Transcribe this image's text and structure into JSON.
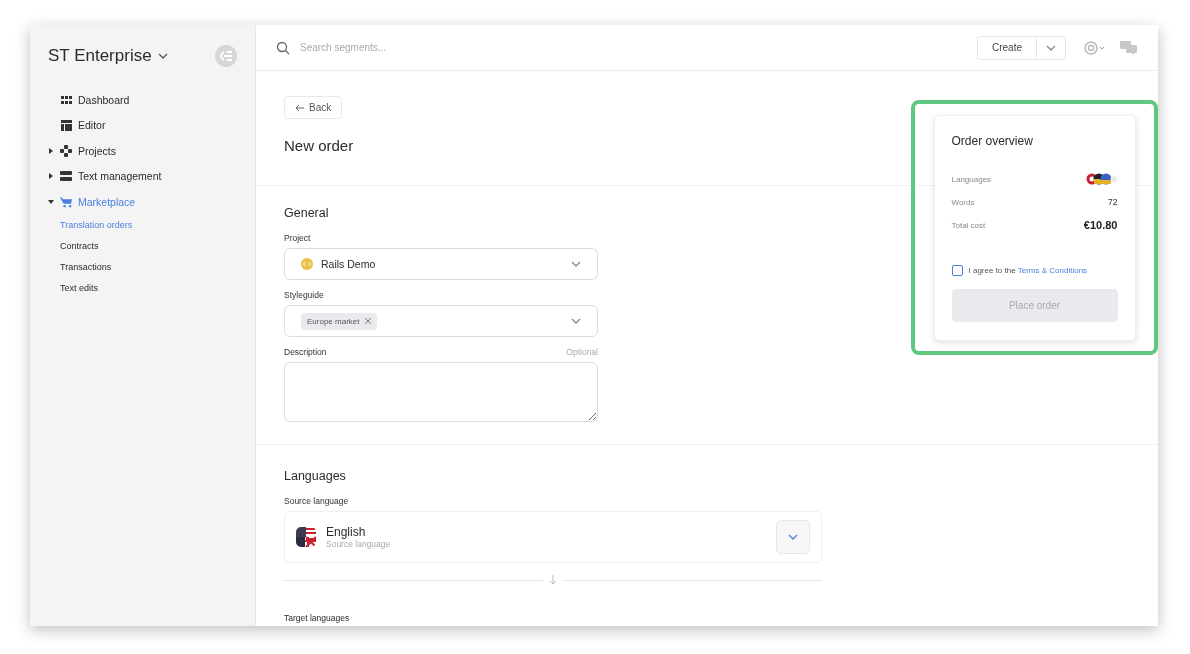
{
  "sidebar": {
    "workspace": "ST Enterprise",
    "items": [
      {
        "kind": "link",
        "label": "Dashboard",
        "selected": false
      },
      {
        "kind": "link",
        "label": "Editor",
        "selected": false
      },
      {
        "kind": "group",
        "label": "Projects",
        "selected": false,
        "expanded": false
      },
      {
        "kind": "group",
        "label": "Text management",
        "selected": false,
        "expanded": false
      },
      {
        "kind": "group",
        "label": "Marketplace",
        "selected": true,
        "expanded": true,
        "children": [
          {
            "label": "Translation orders",
            "selected": true
          },
          {
            "label": "Contracts",
            "selected": false
          },
          {
            "label": "Transactions",
            "selected": false
          },
          {
            "label": "Text edits",
            "selected": false
          }
        ]
      }
    ]
  },
  "topbar": {
    "search": {
      "placeholder": "Search segments..."
    },
    "create_button": "Create"
  },
  "header": {
    "back_button": "Back",
    "title": "New order"
  },
  "general": {
    "title": "General",
    "project": {
      "label": "Project",
      "value": "Rails Demo"
    },
    "styleguide": {
      "label": "Styleguide",
      "tags": [
        "Europe market"
      ]
    },
    "description": {
      "label": "Description",
      "hint": "Optional"
    }
  },
  "languages": {
    "title": "Languages",
    "source": {
      "label": "Source language",
      "name": "English",
      "caption": "Source language"
    },
    "target_label": "Target languages"
  },
  "order_overview": {
    "title": "Order overview",
    "highlighted": true,
    "rows": [
      {
        "kind": "flags",
        "label": "Languages"
      },
      {
        "kind": "text",
        "label": "Words",
        "value": "72"
      },
      {
        "kind": "total",
        "label": "Total cost",
        "value": "€10.80"
      }
    ],
    "agree": {
      "text": "I agree to the",
      "link": "Terms & Conditions",
      "checked": false
    },
    "place_order": {
      "label": "Place order",
      "disabled": true
    }
  }
}
